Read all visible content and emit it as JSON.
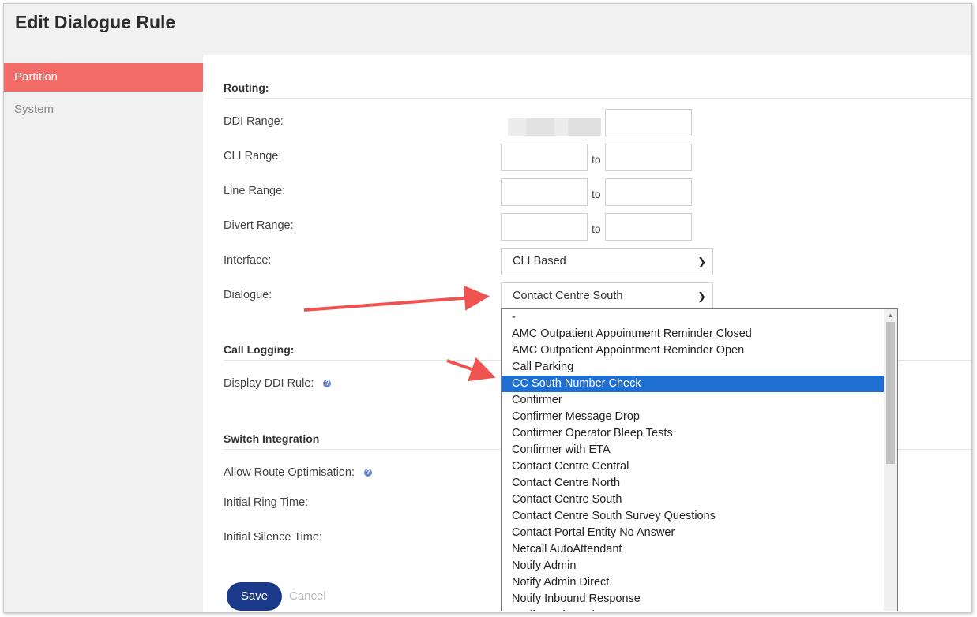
{
  "page": {
    "title": "Edit Dialogue Rule"
  },
  "sidebar": {
    "items": [
      {
        "label": "Partition"
      },
      {
        "label": "System"
      }
    ]
  },
  "routing": {
    "heading": "Routing:",
    "ddi_label": "DDI Range:",
    "cli_label": "CLI Range:",
    "line_label": "Line Range:",
    "divert_label": "Divert Range:",
    "interface_label": "Interface:",
    "dialogue_label": "Dialogue:",
    "to": "to",
    "interface_value": "CLI Based",
    "dialogue_value": "Contact Centre South"
  },
  "call_logging": {
    "heading": "Call Logging:",
    "display_ddi_label": "Display DDI Rule:"
  },
  "switch_integration": {
    "heading": "Switch Integration",
    "allow_route_label": "Allow Route Optimisation:",
    "initial_ring_label": "Initial Ring Time:",
    "initial_silence_label": "Initial Silence Time:"
  },
  "actions": {
    "save": "Save",
    "cancel": "Cancel"
  },
  "dialogue_options": [
    "-",
    "AMC Outpatient Appointment Reminder Closed",
    "AMC Outpatient Appointment Reminder Open",
    "Call Parking",
    "CC South Number Check",
    "Confirmer",
    "Confirmer Message Drop",
    "Confirmer Operator Bleep Tests",
    "Confirmer with ETA",
    "Contact Centre Central",
    "Contact Centre North",
    "Contact Centre South",
    "Contact Centre South Survey Questions",
    "Contact Portal Entity No Answer",
    "Netcall AutoAttendant",
    "Notify Admin",
    "Notify Admin Direct",
    "Notify Inbound Response",
    "Notify Outbound"
  ],
  "highlighted_option": "CC South Number Check",
  "icons": {
    "help": "help-icon",
    "chevron": "chevron-down-icon",
    "annotation": "red-arrow"
  },
  "colors": {
    "accent": "#f26b67",
    "primary": "#1b3a8a",
    "selection": "#1e6fd1",
    "annotation": "#ef5350"
  }
}
